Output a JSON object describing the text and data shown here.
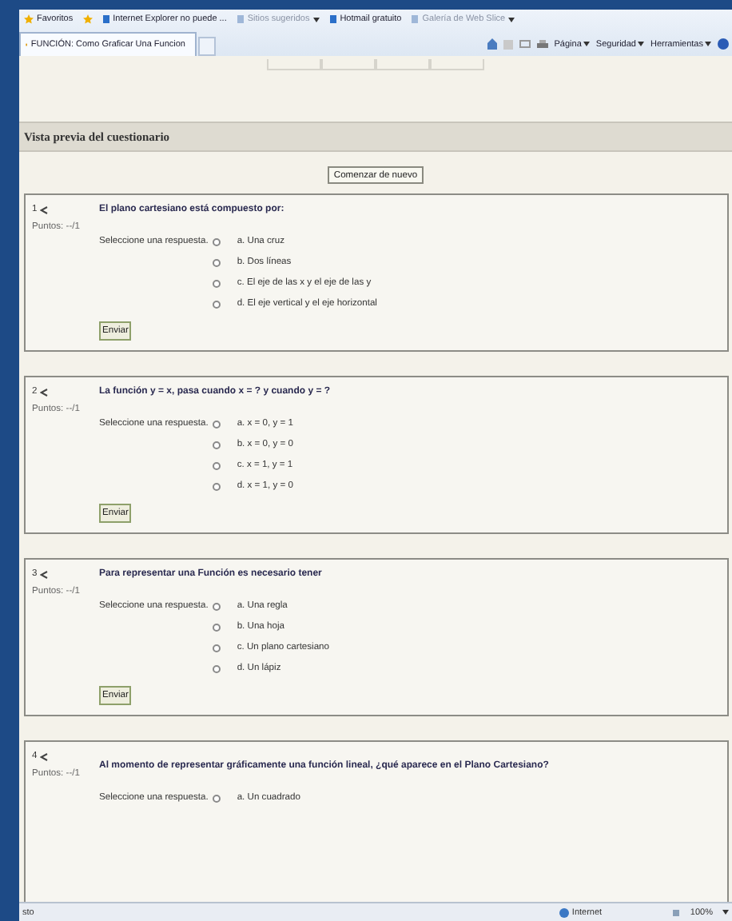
{
  "favorites_bar": {
    "favorites": "Favoritos",
    "links": [
      {
        "label": "Internet Explorer no puede ...",
        "dropdown": false,
        "dim": false
      },
      {
        "label": "Sitios sugeridos",
        "dropdown": true,
        "dim": true
      },
      {
        "label": "Hotmail gratuito",
        "dropdown": false,
        "dim": false
      },
      {
        "label": "Galería de Web Slice",
        "dropdown": true,
        "dim": true
      }
    ]
  },
  "tab": {
    "title": "FUNCIÓN: Como Graficar Una Funcion"
  },
  "command_bar": [
    "Página",
    "Seguridad",
    "Herramientas"
  ],
  "page": {
    "heading": "Vista previa del cuestionario",
    "restart_button": "Comenzar de nuevo",
    "questions": [
      {
        "number": "1",
        "points": "Puntos: --/1",
        "text": "El plano cartesiano está compuesto por:",
        "prompt": "Seleccione una respuesta.",
        "answers": [
          {
            "label": "a. Una cruz",
            "selected": false
          },
          {
            "label": "b. Dos líneas",
            "selected": false
          },
          {
            "label": "c. El eje de las x y el eje de las y",
            "selected": false
          },
          {
            "label": "d. El eje vertical y el eje horizontal",
            "selected": false
          }
        ],
        "submit": "Enviar"
      },
      {
        "number": "2",
        "points": "Puntos: --/1",
        "text": "La función y = x, pasa cuando x = ? y cuando y = ?",
        "prompt": "Seleccione una respuesta.",
        "answers": [
          {
            "label": "a. x = 0, y = 1",
            "selected": false
          },
          {
            "label": "b. x = 0, y = 0",
            "selected": false
          },
          {
            "label": "c. x = 1, y = 1",
            "selected": false
          },
          {
            "label": "d. x = 1, y = 0",
            "selected": false
          }
        ],
        "submit": "Enviar"
      },
      {
        "number": "3",
        "points": "Puntos: --/1",
        "text": "Para representar una Función es necesario tener",
        "prompt": "Seleccione una respuesta.",
        "answers": [
          {
            "label": "a. Una regla",
            "selected": false
          },
          {
            "label": "b. Una hoja",
            "selected": false
          },
          {
            "label": "c. Un plano cartesiano",
            "selected": false
          },
          {
            "label": "d. Un lápiz",
            "selected": false
          }
        ],
        "submit": "Enviar"
      },
      {
        "number": "4",
        "points": "Puntos: --/1",
        "text": "Al momento de representar gráficamente una función lineal, ¿qué aparece en el Plano Cartesiano?",
        "prompt": "Seleccione una respuesta.",
        "answers": [
          {
            "label": "a. Un cuadrado",
            "selected": false
          }
        ]
      }
    ]
  },
  "status_bar": {
    "status": "sto",
    "zone": "Internet",
    "zoom": "100%"
  }
}
